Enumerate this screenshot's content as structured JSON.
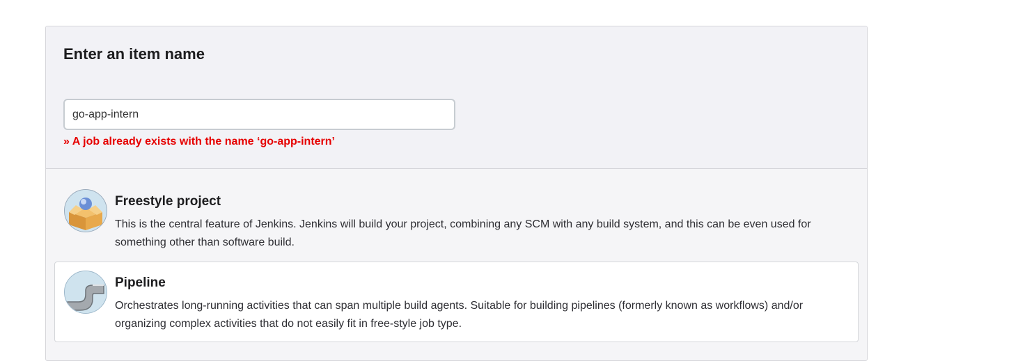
{
  "form": {
    "heading": "Enter an item name",
    "item_name_value": "go-app-intern",
    "error_message": "» A job already exists with the name ‘go-app-intern’"
  },
  "item_types": [
    {
      "title": "Freestyle project",
      "description": "This is the central feature of Jenkins. Jenkins will build your project, combining any SCM with any build system, and this can be even used for something other than software build.",
      "icon": "freestyle-box-icon"
    },
    {
      "title": "Pipeline",
      "description": "Orchestrates long-running activities that can span multiple build agents. Suitable for building pipelines (formerly known as workflows) and/or organizing complex activities that do not easily fit in free-style job type.",
      "icon": "pipeline-pipe-icon"
    }
  ],
  "colors": {
    "error": "#e60000",
    "panel_background": "#f2f2f6",
    "selected_item_background": "#ffffff"
  }
}
